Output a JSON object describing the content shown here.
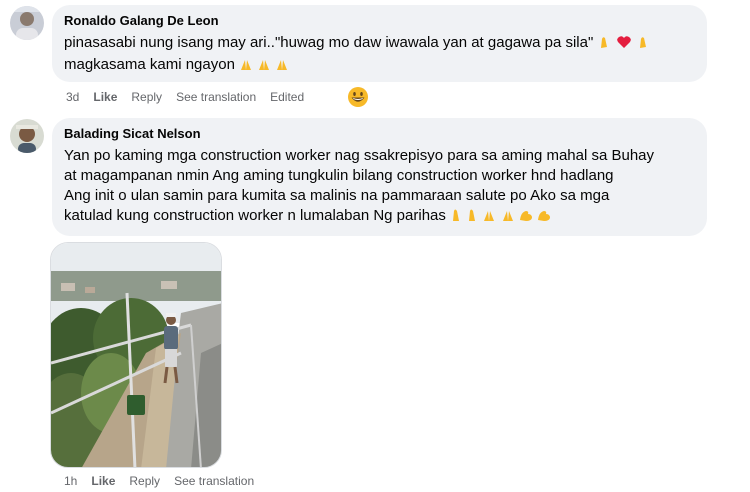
{
  "comments": [
    {
      "author": "Ronaldo Galang De Leon",
      "text_line1": "pinasasabi nung isang may ari..\"huwag mo daw iwawala yan at gagawa pa sila\"",
      "text_line2": "magkasama kami ngayon",
      "time": "3d",
      "like": "Like",
      "reply": "Reply",
      "see_translation": "See translation",
      "edited": "Edited",
      "avatar_icon": "profile-photo-icon",
      "reaction_icon": "grinning-face-icon"
    },
    {
      "author": "Balading Sicat Nelson",
      "text_lines": [
        "Yan po kaming mga construction worker nag ssakrepisyo para sa aming mahal sa Buhay",
        "at magampanan nmin Ang aming tungkulin bilang construction worker hnd hadlang",
        "Ang init o ulan samin para kumita sa malinis na pammaraan salute po Ako sa mga",
        "katulad kung construction worker n lumalaban Ng parihas"
      ],
      "time": "1h",
      "like": "Like",
      "reply": "Reply",
      "see_translation": "See translation",
      "avatar_icon": "profile-photo-icon",
      "attachment": "construction-worker-photo"
    }
  ],
  "colors": {
    "bubble": "#f0f2f5",
    "meta": "#65676b",
    "text": "#050505",
    "heart": "#e41e3f",
    "hand": "#f7b928"
  }
}
